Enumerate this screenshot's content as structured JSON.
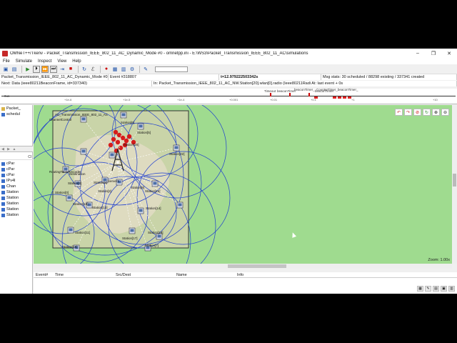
{
  "window": {
    "title": "OMNeT++/Tkenv - Packet_Transmission_IEEE_802_11_AC_Dynamic_Mode #0 - omnetpp.ini - E:\\WS3\\Packet_Transmission_IEEE_802_11_AC\\simulations",
    "minimize": "–",
    "maximize": "❐",
    "close": "✕"
  },
  "menu": [
    "File",
    "Simulate",
    "Inspect",
    "View",
    "Help"
  ],
  "toolbar": {
    "icons": [
      "open-icon",
      "save-icon",
      "run-icon",
      "step-icon",
      "run-fast-icon",
      "run-express-icon",
      "until-icon",
      "stop-icon",
      "rebuild-icon",
      "find-icon",
      "record-icon",
      "layout-icon",
      "graph-icon",
      "options-icon"
    ]
  },
  "info": {
    "network": "Packet_Transmission_IEEE_802_11_AC_Dynamic_Mode #0: Packet_Transmi",
    "event": "Event #318807",
    "simtime": "t=12.979222503342s",
    "msgstats": "Msg stats: 30 scheduled / 88298 existing / 337341 created",
    "next": "Next: Data (ieee80211BeaconFrame, id=337340)",
    "in": "In: Packet_Transmission_IEEE_802_11_AC_NW.Station[20].wlan[0].radio (Ieee80211Radi At: last event + 0s"
  },
  "timeline": {
    "left_label": "0us",
    "labels": [
      "Timeout",
      "beaconTimer",
      "beaconTimer_",
      "beaconTimer",
      "CounterTimer_beaconTimer_"
    ],
    "ticks": [
      "+1e-6",
      "+1e-5",
      "+1e-4",
      "+0.001",
      "+0.01",
      "+0.1",
      "+1",
      "+10"
    ]
  },
  "tree": {
    "items": [
      "Packet_",
      "schedul"
    ],
    "list_header": "Cl",
    "list_items": [
      "cPar",
      "cPar",
      "cPar",
      "IPv4I",
      "Chan",
      "Station",
      "Station",
      "Station",
      "Station",
      "Station"
    ]
  },
  "canvas": {
    "title": "AC_Transmission_IEEE_802_11_AC",
    "labels": [
      "ChannelControl",
      "Station[6]",
      "Station[5]",
      "Station[20]",
      "Destination",
      "Station[22]",
      "RoutingTableRecorder",
      "Station[3]",
      "Station[8]",
      "Station[9]",
      "Station[16]",
      "Station[0]",
      "Station[10]",
      "Station[14]",
      "Station[12]",
      "Station[19]",
      "Station[17]",
      "Station[11]",
      "Station[18]",
      "Station[7]",
      "Server1",
      "Station[2]"
    ],
    "zoom": "Zoom: 1.00x"
  },
  "log": {
    "columns": [
      "Event#",
      "Time",
      "Src/Dest",
      "Name",
      "Info"
    ]
  }
}
